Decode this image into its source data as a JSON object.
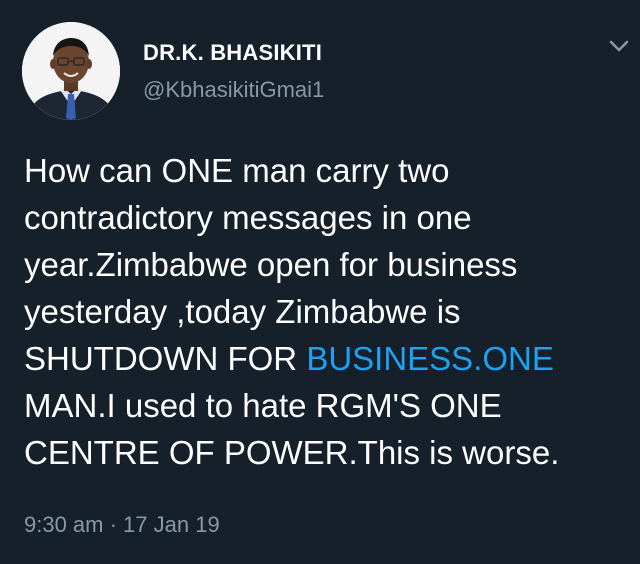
{
  "author": {
    "display_name": "DR.K. BHASIKITI",
    "handle": "@KbhasikitiGmai1",
    "avatar_icon": "profile-photo"
  },
  "menu": {
    "icon": "chevron-down-icon"
  },
  "tweet": {
    "line1": "How can ONE man carry two",
    "line2": "contradictory messages in one",
    "line3": "year.Zimbabwe open for business",
    "line4": "yesterday ,today Zimbabwe is",
    "line5_prefix": "SHUTDOWN FOR ",
    "line5_link": "BUSINESS.ONE",
    "line6": "MAN.I used to hate RGM'S ONE",
    "line7": "CENTRE OF POWER.This is worse."
  },
  "meta": {
    "timestamp": "9:30 am · 17 Jan 19"
  },
  "colors": {
    "background": "#15202b",
    "text": "#ffffff",
    "secondary_text": "#8899a6",
    "link": "#1da1f2"
  }
}
